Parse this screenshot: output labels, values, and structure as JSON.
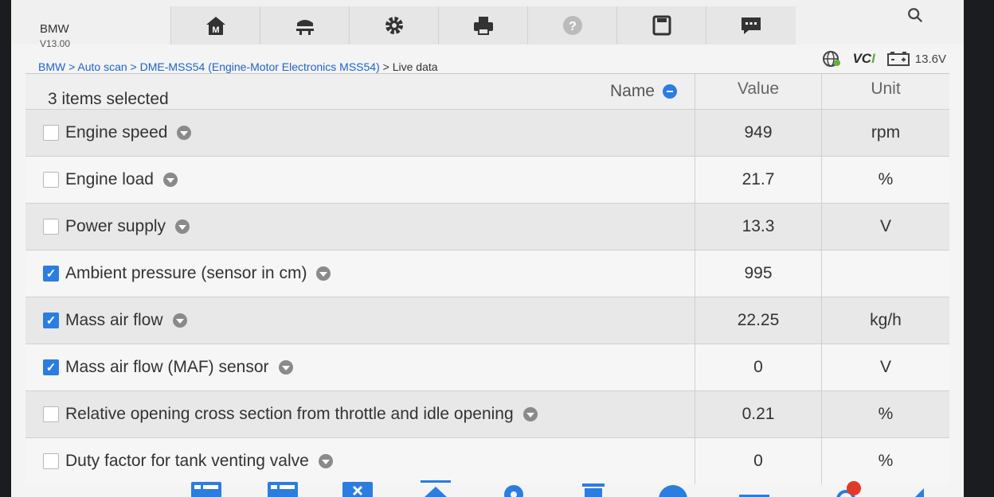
{
  "app": {
    "brand": "BMW",
    "version": "V13.00"
  },
  "toolbar": {
    "icons": [
      "home-icon",
      "car-lift-icon",
      "settings-gear-icon",
      "printer-icon",
      "help-icon",
      "save-icon",
      "message-icon"
    ]
  },
  "status": {
    "vci": "VC",
    "vci_accent": "I",
    "battery": "13.6V"
  },
  "breadcrumb": {
    "links": [
      "BMW",
      "Auto scan",
      "DME-MSS54 (Engine-Motor Electronics MSS54)"
    ],
    "separator": " > ",
    "current": "Live data"
  },
  "table": {
    "selected_text": "3 items selected",
    "headers": {
      "name": "Name",
      "value": "Value",
      "unit": "Unit"
    },
    "rows": [
      {
        "name": "Engine speed",
        "value": "949",
        "unit": "rpm",
        "checked": false
      },
      {
        "name": "Engine load",
        "value": "21.7",
        "unit": "%",
        "checked": false
      },
      {
        "name": "Power supply",
        "value": "13.3",
        "unit": "V",
        "checked": false
      },
      {
        "name": "Ambient pressure (sensor in cm)",
        "value": "995",
        "unit": "",
        "checked": true
      },
      {
        "name": "Mass air flow",
        "value": "22.25",
        "unit": "kg/h",
        "checked": true
      },
      {
        "name": "Mass air flow (MAF) sensor",
        "value": "0",
        "unit": "V",
        "checked": true
      },
      {
        "name": "Relative opening cross section from throttle and idle opening",
        "value": "0.21",
        "unit": "%",
        "checked": false
      },
      {
        "name": "Duty factor for tank venting valve",
        "value": "0",
        "unit": "%",
        "checked": false
      }
    ]
  },
  "colors": {
    "accent": "#2b7de0",
    "link": "#1e64c8",
    "vci_green": "#5db43a"
  }
}
